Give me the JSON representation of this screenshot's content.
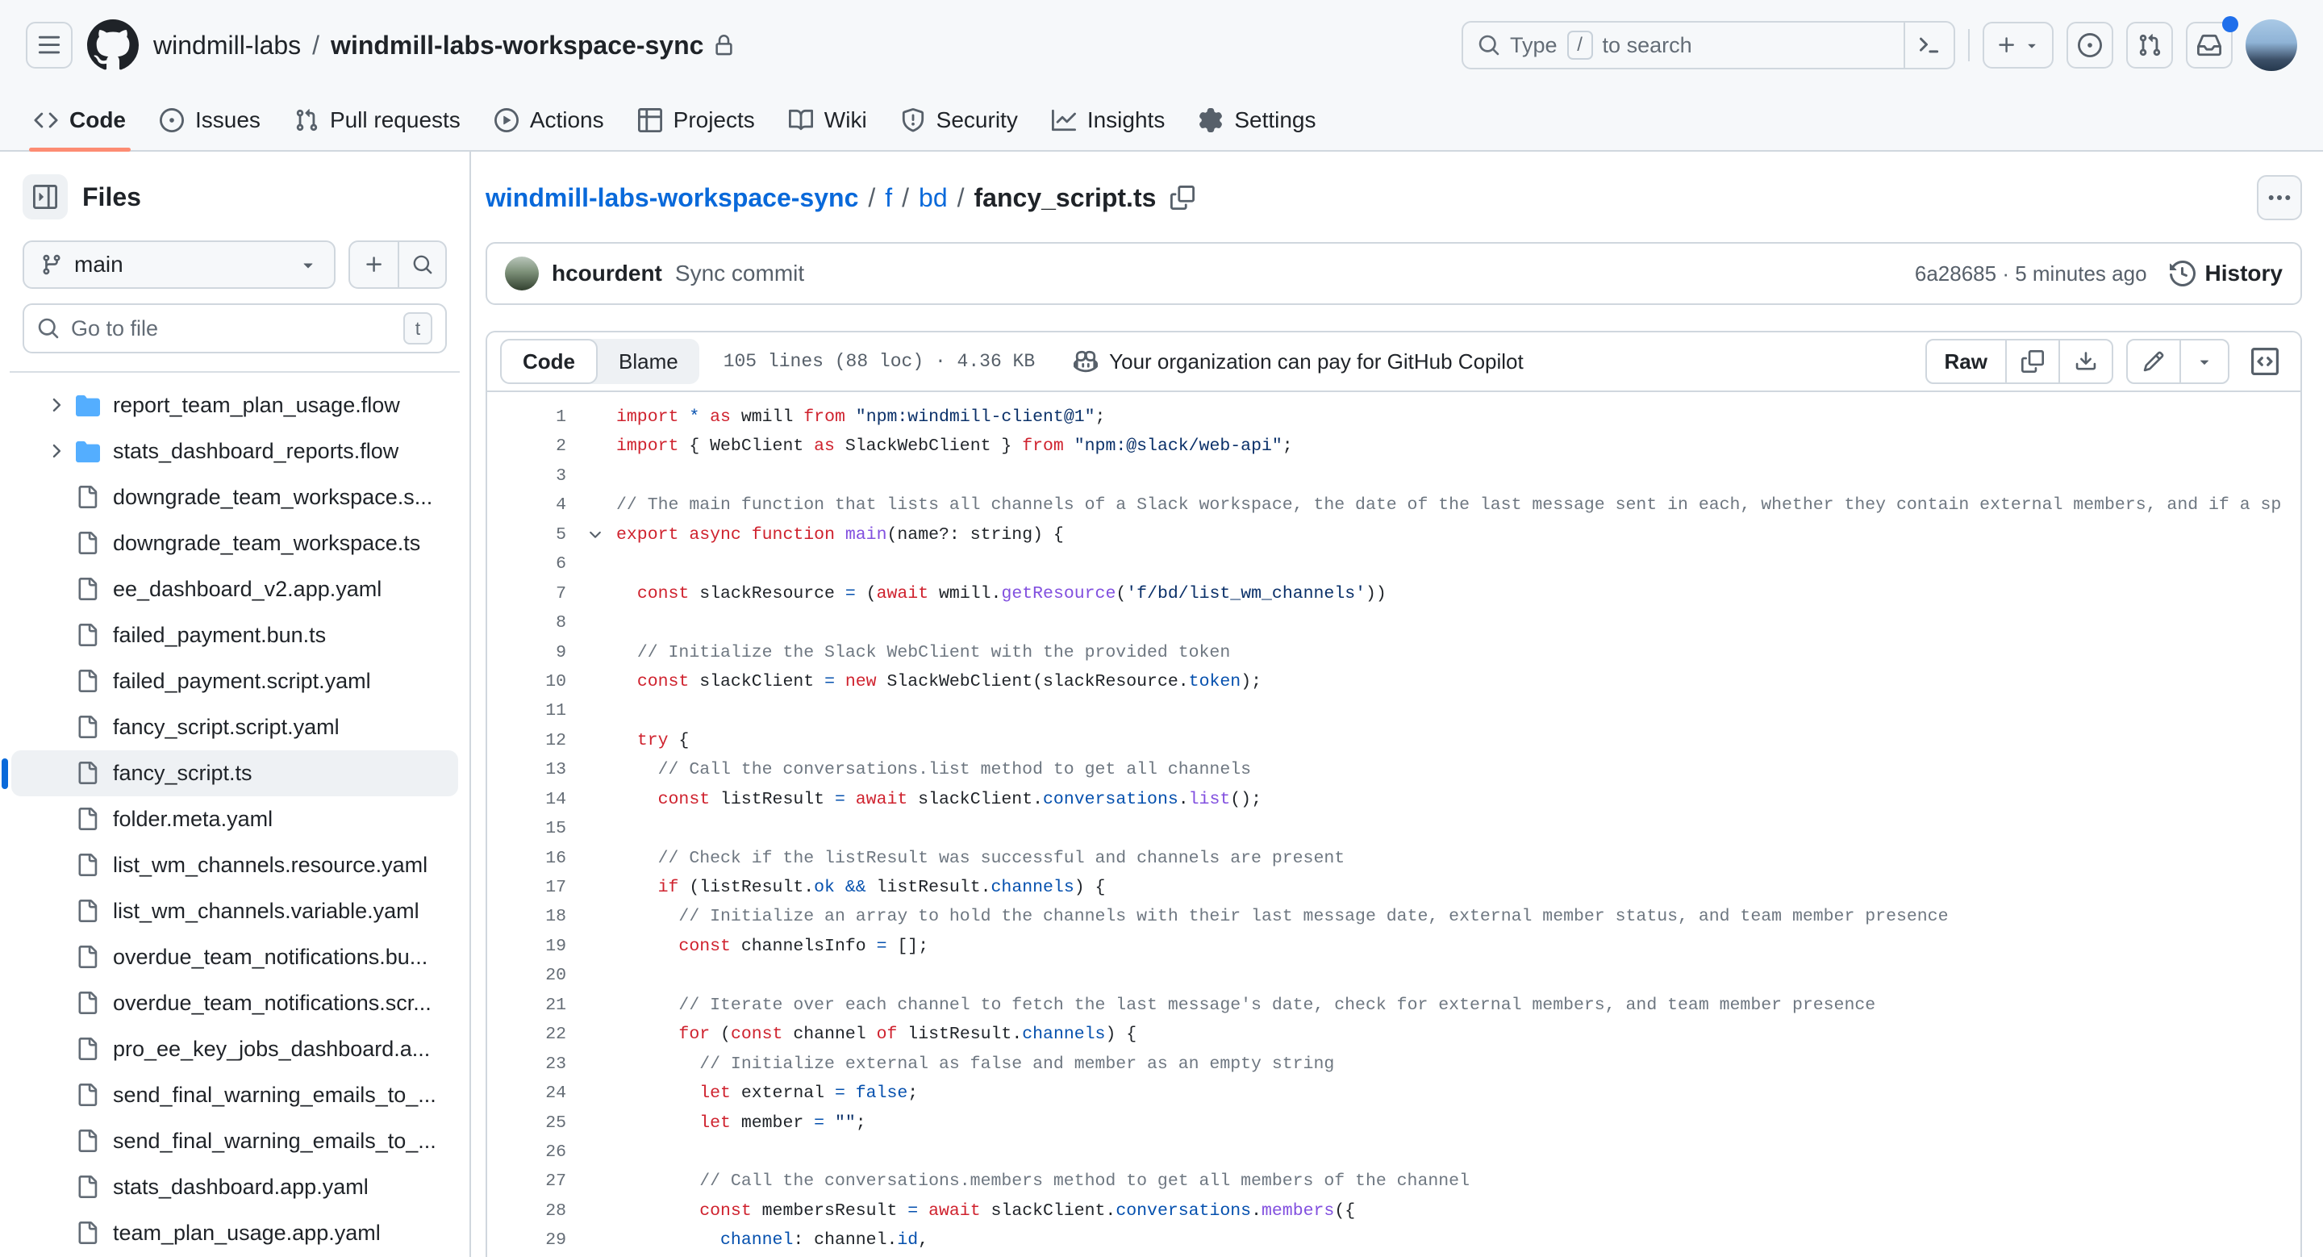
{
  "colors": {
    "accent_underline": "#fd8c73",
    "link": "#0969da",
    "folder_icon": "#54aeff",
    "notification_dot": "#1f6feb",
    "keyword": "#cf222e",
    "constant": "#0550ae",
    "function": "#8250df",
    "string": "#0a3069",
    "comment": "#6e7781"
  },
  "header": {
    "org": "windmill-labs",
    "sep": "/",
    "repo": "windmill-labs-workspace-sync",
    "search_prefix": "Type",
    "search_key": "/",
    "search_suffix": "to search"
  },
  "tabs": [
    {
      "label": "Code",
      "active": true
    },
    {
      "label": "Issues",
      "active": false
    },
    {
      "label": "Pull requests",
      "active": false
    },
    {
      "label": "Actions",
      "active": false
    },
    {
      "label": "Projects",
      "active": false
    },
    {
      "label": "Wiki",
      "active": false
    },
    {
      "label": "Security",
      "active": false
    },
    {
      "label": "Insights",
      "active": false
    },
    {
      "label": "Settings",
      "active": false
    }
  ],
  "sidebar": {
    "title": "Files",
    "branch": "main",
    "goto_placeholder": "Go to file",
    "goto_key": "t",
    "tree": [
      {
        "name": "report_team_plan_usage.flow",
        "type": "folder",
        "selected": false
      },
      {
        "name": "stats_dashboard_reports.flow",
        "type": "folder",
        "selected": false
      },
      {
        "name": "downgrade_team_workspace.s...",
        "type": "file",
        "selected": false
      },
      {
        "name": "downgrade_team_workspace.ts",
        "type": "file",
        "selected": false
      },
      {
        "name": "ee_dashboard_v2.app.yaml",
        "type": "file",
        "selected": false
      },
      {
        "name": "failed_payment.bun.ts",
        "type": "file",
        "selected": false
      },
      {
        "name": "failed_payment.script.yaml",
        "type": "file",
        "selected": false
      },
      {
        "name": "fancy_script.script.yaml",
        "type": "file",
        "selected": false
      },
      {
        "name": "fancy_script.ts",
        "type": "file",
        "selected": true
      },
      {
        "name": "folder.meta.yaml",
        "type": "file",
        "selected": false
      },
      {
        "name": "list_wm_channels.resource.yaml",
        "type": "file",
        "selected": false
      },
      {
        "name": "list_wm_channels.variable.yaml",
        "type": "file",
        "selected": false
      },
      {
        "name": "overdue_team_notifications.bu...",
        "type": "file",
        "selected": false
      },
      {
        "name": "overdue_team_notifications.scr...",
        "type": "file",
        "selected": false
      },
      {
        "name": "pro_ee_key_jobs_dashboard.a...",
        "type": "file",
        "selected": false
      },
      {
        "name": "send_final_warning_emails_to_...",
        "type": "file",
        "selected": false
      },
      {
        "name": "send_final_warning_emails_to_...",
        "type": "file",
        "selected": false
      },
      {
        "name": "stats_dashboard.app.yaml",
        "type": "file",
        "selected": false
      },
      {
        "name": "team_plan_usage.app.yaml",
        "type": "file",
        "selected": false
      }
    ]
  },
  "breadcrumb": {
    "repo": "windmill-labs-workspace-sync",
    "sep": "/",
    "dir1": "f",
    "dir2": "bd",
    "file": "fancy_script.ts"
  },
  "commit": {
    "author": "hcourdent",
    "message": "Sync commit",
    "meta": "6a28685 · 5 minutes ago",
    "history_label": "History"
  },
  "toolbar": {
    "code_tab": "Code",
    "blame_tab": "Blame",
    "file_meta": "105 lines (88 loc) · 4.36 KB",
    "copilot_note": "Your organization can pay for GitHub Copilot",
    "raw_label": "Raw"
  },
  "code": {
    "lines": [
      {
        "n": 1,
        "fold": false,
        "tokens": [
          [
            "k",
            "import"
          ],
          [
            "p",
            " "
          ],
          [
            "b",
            "*"
          ],
          [
            "p",
            " "
          ],
          [
            "k",
            "as"
          ],
          [
            "p",
            " wmill "
          ],
          [
            "k",
            "from"
          ],
          [
            "p",
            " "
          ],
          [
            "s",
            "\"npm:windmill-client@1\""
          ],
          [
            "p",
            ";"
          ]
        ]
      },
      {
        "n": 2,
        "fold": false,
        "tokens": [
          [
            "k",
            "import"
          ],
          [
            "p",
            " { WebClient "
          ],
          [
            "k",
            "as"
          ],
          [
            "p",
            " SlackWebClient } "
          ],
          [
            "k",
            "from"
          ],
          [
            "p",
            " "
          ],
          [
            "s",
            "\"npm:@slack/web-api\""
          ],
          [
            "p",
            ";"
          ]
        ]
      },
      {
        "n": 3,
        "fold": false,
        "tokens": []
      },
      {
        "n": 4,
        "fold": false,
        "tokens": [
          [
            "c",
            "// The main function that lists all channels of a Slack workspace, the date of the last message sent in each, whether they contain external members, and if a sp"
          ]
        ]
      },
      {
        "n": 5,
        "fold": true,
        "tokens": [
          [
            "k",
            "export"
          ],
          [
            "p",
            " "
          ],
          [
            "k",
            "async"
          ],
          [
            "p",
            " "
          ],
          [
            "k",
            "function"
          ],
          [
            "p",
            " "
          ],
          [
            "f",
            "main"
          ],
          [
            "p",
            "(name?: string) {"
          ]
        ]
      },
      {
        "n": 6,
        "fold": false,
        "tokens": []
      },
      {
        "n": 7,
        "fold": false,
        "tokens": [
          [
            "p",
            "  "
          ],
          [
            "k",
            "const"
          ],
          [
            "p",
            " slackResource "
          ],
          [
            "b",
            "="
          ],
          [
            "p",
            " ("
          ],
          [
            "k",
            "await"
          ],
          [
            "p",
            " wmill."
          ],
          [
            "f",
            "getResource"
          ],
          [
            "p",
            "("
          ],
          [
            "s",
            "'f/bd/list_wm_channels'"
          ],
          [
            "p",
            "))"
          ]
        ]
      },
      {
        "n": 8,
        "fold": false,
        "tokens": []
      },
      {
        "n": 9,
        "fold": false,
        "tokens": [
          [
            "p",
            "  "
          ],
          [
            "c",
            "// Initialize the Slack WebClient with the provided token"
          ]
        ]
      },
      {
        "n": 10,
        "fold": false,
        "tokens": [
          [
            "p",
            "  "
          ],
          [
            "k",
            "const"
          ],
          [
            "p",
            " slackClient "
          ],
          [
            "b",
            "="
          ],
          [
            "p",
            " "
          ],
          [
            "k",
            "new"
          ],
          [
            "p",
            " SlackWebClient(slackResource."
          ],
          [
            "b",
            "token"
          ],
          [
            "p",
            ");"
          ]
        ]
      },
      {
        "n": 11,
        "fold": false,
        "tokens": []
      },
      {
        "n": 12,
        "fold": false,
        "tokens": [
          [
            "p",
            "  "
          ],
          [
            "k",
            "try"
          ],
          [
            "p",
            " {"
          ]
        ]
      },
      {
        "n": 13,
        "fold": false,
        "tokens": [
          [
            "p",
            "    "
          ],
          [
            "c",
            "// Call the conversations.list method to get all channels"
          ]
        ]
      },
      {
        "n": 14,
        "fold": false,
        "tokens": [
          [
            "p",
            "    "
          ],
          [
            "k",
            "const"
          ],
          [
            "p",
            " listResult "
          ],
          [
            "b",
            "="
          ],
          [
            "p",
            " "
          ],
          [
            "k",
            "await"
          ],
          [
            "p",
            " slackClient."
          ],
          [
            "b",
            "conversations"
          ],
          [
            "p",
            "."
          ],
          [
            "f",
            "list"
          ],
          [
            "p",
            "();"
          ]
        ]
      },
      {
        "n": 15,
        "fold": false,
        "tokens": []
      },
      {
        "n": 16,
        "fold": false,
        "tokens": [
          [
            "p",
            "    "
          ],
          [
            "c",
            "// Check if the listResult was successful and channels are present"
          ]
        ]
      },
      {
        "n": 17,
        "fold": false,
        "tokens": [
          [
            "p",
            "    "
          ],
          [
            "k",
            "if"
          ],
          [
            "p",
            " (listResult."
          ],
          [
            "b",
            "ok"
          ],
          [
            "p",
            " "
          ],
          [
            "b",
            "&&"
          ],
          [
            "p",
            " listResult."
          ],
          [
            "b",
            "channels"
          ],
          [
            "p",
            ") {"
          ]
        ]
      },
      {
        "n": 18,
        "fold": false,
        "tokens": [
          [
            "p",
            "      "
          ],
          [
            "c",
            "// Initialize an array to hold the channels with their last message date, external member status, and team member presence"
          ]
        ]
      },
      {
        "n": 19,
        "fold": false,
        "tokens": [
          [
            "p",
            "      "
          ],
          [
            "k",
            "const"
          ],
          [
            "p",
            " channelsInfo "
          ],
          [
            "b",
            "="
          ],
          [
            "p",
            " [];"
          ]
        ]
      },
      {
        "n": 20,
        "fold": false,
        "tokens": []
      },
      {
        "n": 21,
        "fold": false,
        "tokens": [
          [
            "p",
            "      "
          ],
          [
            "c",
            "// Iterate over each channel to fetch the last message's date, check for external members, and team member presence"
          ]
        ]
      },
      {
        "n": 22,
        "fold": false,
        "tokens": [
          [
            "p",
            "      "
          ],
          [
            "k",
            "for"
          ],
          [
            "p",
            " ("
          ],
          [
            "k",
            "const"
          ],
          [
            "p",
            " channel "
          ],
          [
            "k",
            "of"
          ],
          [
            "p",
            " listResult."
          ],
          [
            "b",
            "channels"
          ],
          [
            "p",
            ") {"
          ]
        ]
      },
      {
        "n": 23,
        "fold": false,
        "tokens": [
          [
            "p",
            "        "
          ],
          [
            "c",
            "// Initialize external as false and member as an empty string"
          ]
        ]
      },
      {
        "n": 24,
        "fold": false,
        "tokens": [
          [
            "p",
            "        "
          ],
          [
            "k",
            "let"
          ],
          [
            "p",
            " external "
          ],
          [
            "b",
            "="
          ],
          [
            "p",
            " "
          ],
          [
            "b",
            "false"
          ],
          [
            "p",
            ";"
          ]
        ]
      },
      {
        "n": 25,
        "fold": false,
        "tokens": [
          [
            "p",
            "        "
          ],
          [
            "k",
            "let"
          ],
          [
            "p",
            " member "
          ],
          [
            "b",
            "="
          ],
          [
            "p",
            " "
          ],
          [
            "s",
            "\"\""
          ],
          [
            "p",
            ";"
          ]
        ]
      },
      {
        "n": 26,
        "fold": false,
        "tokens": []
      },
      {
        "n": 27,
        "fold": false,
        "tokens": [
          [
            "p",
            "        "
          ],
          [
            "c",
            "// Call the conversations.members method to get all members of the channel"
          ]
        ]
      },
      {
        "n": 28,
        "fold": false,
        "tokens": [
          [
            "p",
            "        "
          ],
          [
            "k",
            "const"
          ],
          [
            "p",
            " membersResult "
          ],
          [
            "b",
            "="
          ],
          [
            "p",
            " "
          ],
          [
            "k",
            "await"
          ],
          [
            "p",
            " slackClient."
          ],
          [
            "b",
            "conversations"
          ],
          [
            "p",
            "."
          ],
          [
            "f",
            "members"
          ],
          [
            "p",
            "({"
          ]
        ]
      },
      {
        "n": 29,
        "fold": false,
        "tokens": [
          [
            "p",
            "          "
          ],
          [
            "b",
            "channel"
          ],
          [
            "p",
            ": channel."
          ],
          [
            "b",
            "id"
          ],
          [
            "p",
            ","
          ]
        ]
      }
    ]
  }
}
